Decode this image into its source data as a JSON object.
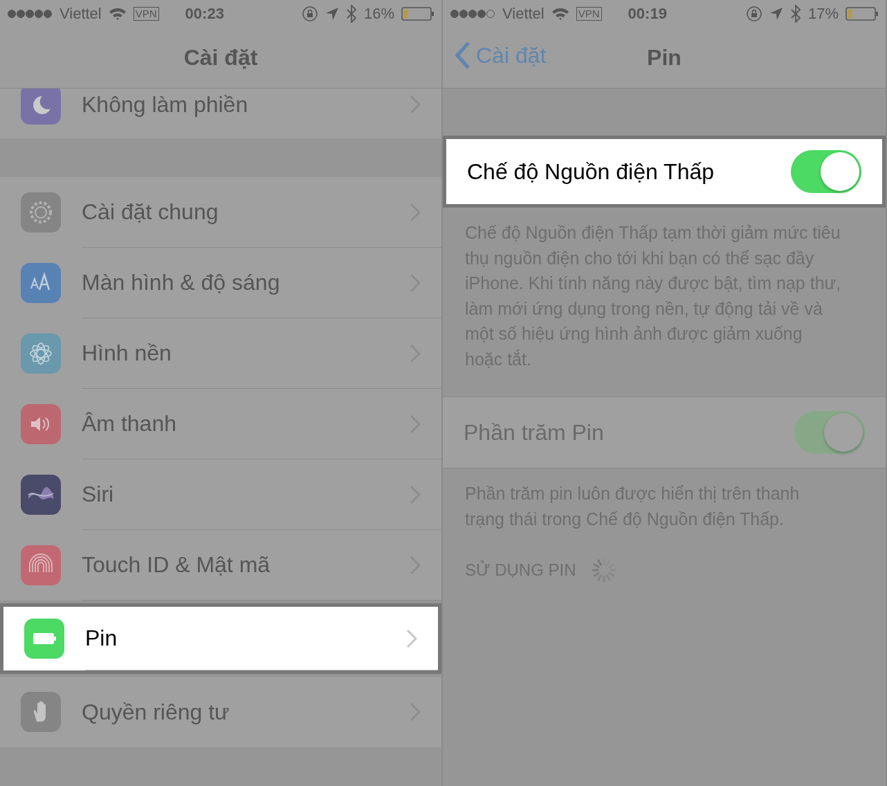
{
  "panels": [
    {
      "kind": "list",
      "status_bar": {
        "carrier": "Viettel",
        "vpn": "VPN",
        "time": "00:23",
        "battery": "16%"
      },
      "nav": {
        "title": "Cài đặt"
      },
      "groups": [
        [
          {
            "label": "Không làm phiền",
            "kind": "moon",
            "color": "#7872a6",
            "selected": false
          }
        ],
        [
          {
            "label": "Cài đặt chung",
            "kind": "gear",
            "color": "#858585",
            "selected": false
          },
          {
            "label": "Màn hình & độ sáng",
            "kind": "text",
            "color": "#5882b4",
            "selected": false
          },
          {
            "label": "Hình nền",
            "kind": "flower",
            "color": "#6a98ac",
            "selected": false
          },
          {
            "label": "Âm thanh",
            "kind": "speaker",
            "color": "#bd6870",
            "selected": false
          },
          {
            "label": "Siri",
            "kind": "siri",
            "color": "#4a4a6a",
            "selected": false
          },
          {
            "label": "Touch ID & Mật mã",
            "kind": "fingerprint",
            "color": "#c26872",
            "selected": false
          },
          {
            "label": "Pin",
            "kind": "battery",
            "color": "#4cd964",
            "selected": true
          },
          {
            "label": "Quyền riêng tư",
            "kind": "hand",
            "color": "#858585",
            "selected": false
          }
        ]
      ]
    },
    {
      "kind": "detail",
      "status_bar": {
        "carrier": "Viettel",
        "vpn": "VPN",
        "time": "00:19",
        "battery": "17%"
      },
      "nav": {
        "back": "Cài đặt",
        "title": "Pin"
      },
      "settings": [
        {
          "label": "Chế độ Nguồn điện Thấp",
          "on": true,
          "selected": true,
          "footer": "Chế độ Nguồn điện Thấp tạm thời giảm mức tiêu thụ nguồn điện cho tới khi bạn có thể sạc đầy iPhone. Khi tính năng này được bật, tìm nạp thư, làm mới ứng dụng trong nền, tự động tải về và một số hiệu ứng hình ảnh được giảm xuống hoặc tắt."
        },
        {
          "label": "Phần trăm Pin",
          "on": true,
          "selected": false,
          "footer": "Phần trăm pin luôn được hiển thị trên thanh trạng thái trong Chế độ Nguồn điện Thấp."
        }
      ],
      "section_header": "SỬ DỤNG PIN"
    }
  ]
}
